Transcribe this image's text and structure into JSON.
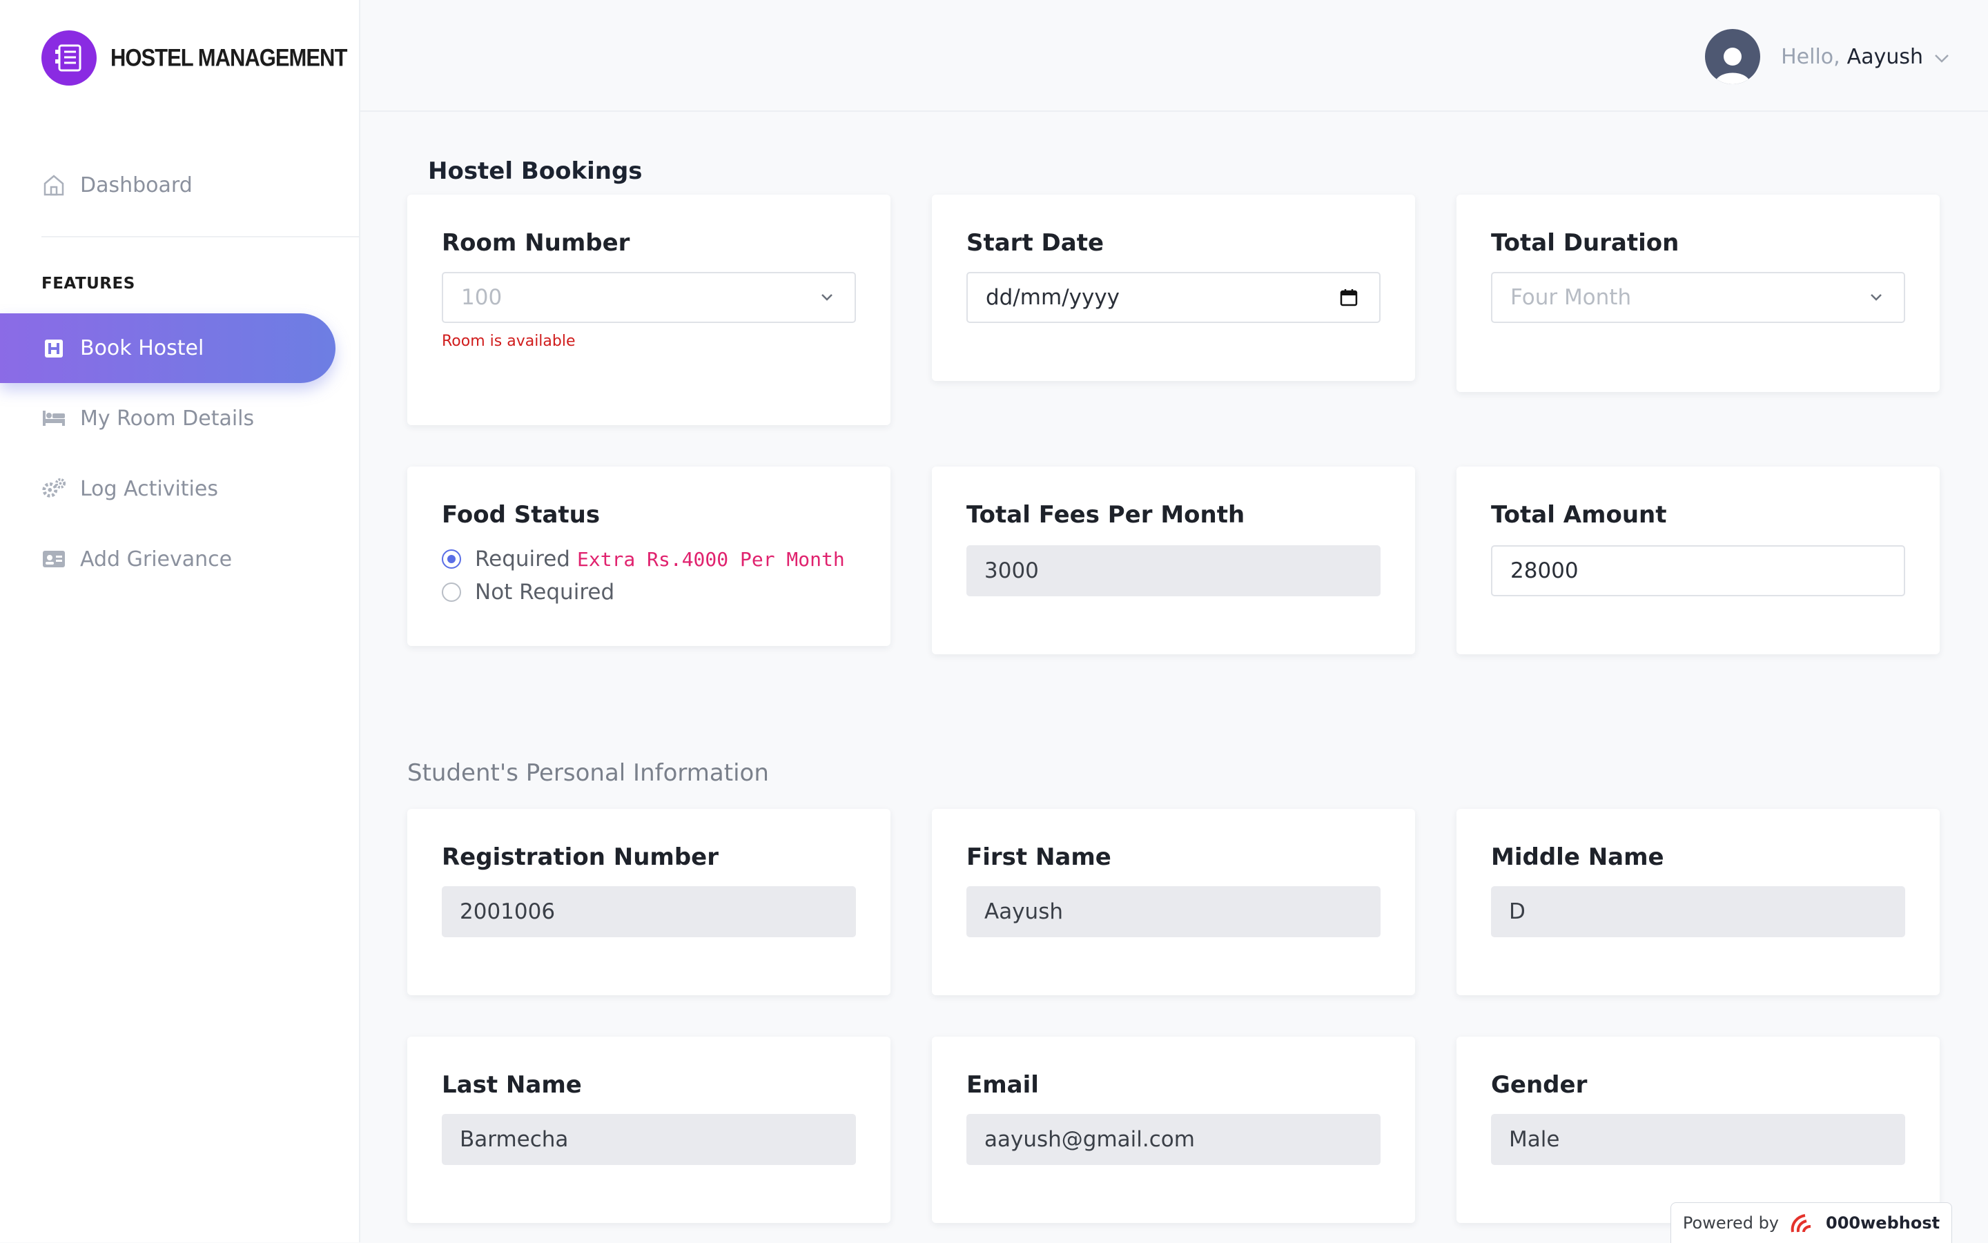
{
  "app": {
    "logo_text": "HOSTEL MANAGEMENT"
  },
  "sidebar": {
    "dashboard": "Dashboard",
    "features_label": "FEATURES",
    "items": [
      "Book Hostel",
      "My Room Details",
      "Log Activities",
      "Add Grievance"
    ],
    "active_gradient": [
      "#8b6be6",
      "#6d7ee3"
    ]
  },
  "header": {
    "greeting": "Hello,",
    "user_name": "Aayush"
  },
  "bookings": {
    "title": "Hostel Bookings",
    "room_number": {
      "label": "Room Number",
      "value": "100",
      "hint": "Room is available"
    },
    "start_date": {
      "label": "Start Date",
      "placeholder": "dd/mm/yyyy"
    },
    "total_duration": {
      "label": "Total Duration",
      "value": "Four Month"
    },
    "food_status": {
      "label": "Food Status",
      "option1": "Required",
      "option1_extra": "Extra Rs.4000 Per Month",
      "option2": "Not Required",
      "selected": "Required"
    },
    "fees_per_month": {
      "label": "Total Fees Per Month",
      "value": "3000"
    },
    "total_amount": {
      "label": "Total Amount",
      "value": "28000"
    }
  },
  "personal": {
    "title": "Student's Personal Information",
    "registration": {
      "label": "Registration Number",
      "value": "2001006"
    },
    "first_name": {
      "label": "First Name",
      "value": "Aayush"
    },
    "middle_name": {
      "label": "Middle Name",
      "value": "D"
    },
    "last_name": {
      "label": "Last Name",
      "value": "Barmecha"
    },
    "email": {
      "label": "Email",
      "value": "aayush@gmail.com"
    },
    "gender": {
      "label": "Gender",
      "value": "Male"
    }
  },
  "footer_badge": {
    "prefix": "Powered by",
    "brand": "000webhost"
  },
  "colors": {
    "accent": "#5a6ee6",
    "logo": "#8a2be2",
    "error": "#d01c1c",
    "extra_text": "#e0226e"
  }
}
